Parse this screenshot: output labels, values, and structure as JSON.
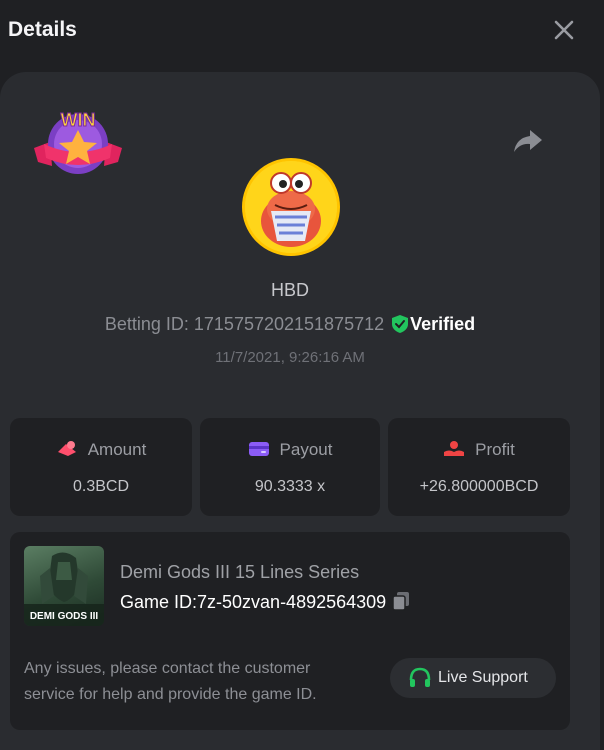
{
  "header": {
    "title": "Details"
  },
  "badge": {
    "text": "WIN"
  },
  "user": {
    "name": "HBD"
  },
  "bet": {
    "id_label": "Betting ID: 1715757202151875712",
    "verified_label": "Verified",
    "timestamp": "11/7/2021, 9:26:16 AM"
  },
  "stats": {
    "amount": {
      "label": "Amount",
      "value": "0.3BCD"
    },
    "payout": {
      "label": "Payout",
      "value": "90.3333 x"
    },
    "profit": {
      "label": "Profit",
      "value": "+26.800000BCD"
    }
  },
  "game": {
    "name": "Demi Gods III 15 Lines Series",
    "id_label": "Game ID:7z-50zvan-4892564309",
    "thumb_text": "DEMI GODS III",
    "help_text": "Any issues, please contact the customer service for help and provide the game ID.",
    "support_label": "Live Support"
  },
  "colors": {
    "background": "#1f2023",
    "panel": "#2a2c30",
    "verified_green": "#22c55e",
    "amount_icon": "#ff4f6d",
    "payout_icon": "#8b5cf6",
    "profit_icon": "#ef4444",
    "support_icon": "#22c55e"
  },
  "icons": [
    "close-icon",
    "share-icon",
    "shield-check-icon",
    "coins-icon",
    "wallet-icon",
    "profit-hand-icon",
    "copy-icon",
    "headset-icon"
  ]
}
